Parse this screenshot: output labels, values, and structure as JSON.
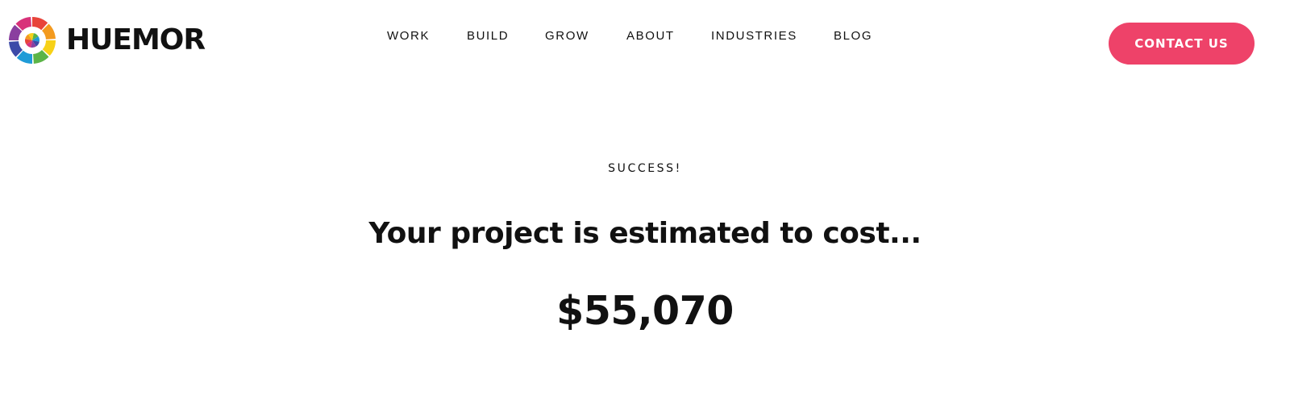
{
  "brand": {
    "name": "HUEMOR",
    "logo_icon": "color-wheel-logo-icon",
    "logo_colors": [
      "#e8443a",
      "#f39a1f",
      "#f7d117",
      "#5bb447",
      "#1f9bd7",
      "#3c4aa8",
      "#8a3f9f",
      "#d8327a"
    ]
  },
  "nav": {
    "items": [
      {
        "label": "WORK"
      },
      {
        "label": "BUILD"
      },
      {
        "label": "GROW"
      },
      {
        "label": "ABOUT"
      },
      {
        "label": "INDUSTRIES"
      },
      {
        "label": "BLOG"
      }
    ]
  },
  "cta": {
    "label": "CONTACT US",
    "color": "#ee4269"
  },
  "result": {
    "eyebrow": "SUCCESS!",
    "headline": "Your project is estimated to cost...",
    "amount": "$55,070"
  }
}
